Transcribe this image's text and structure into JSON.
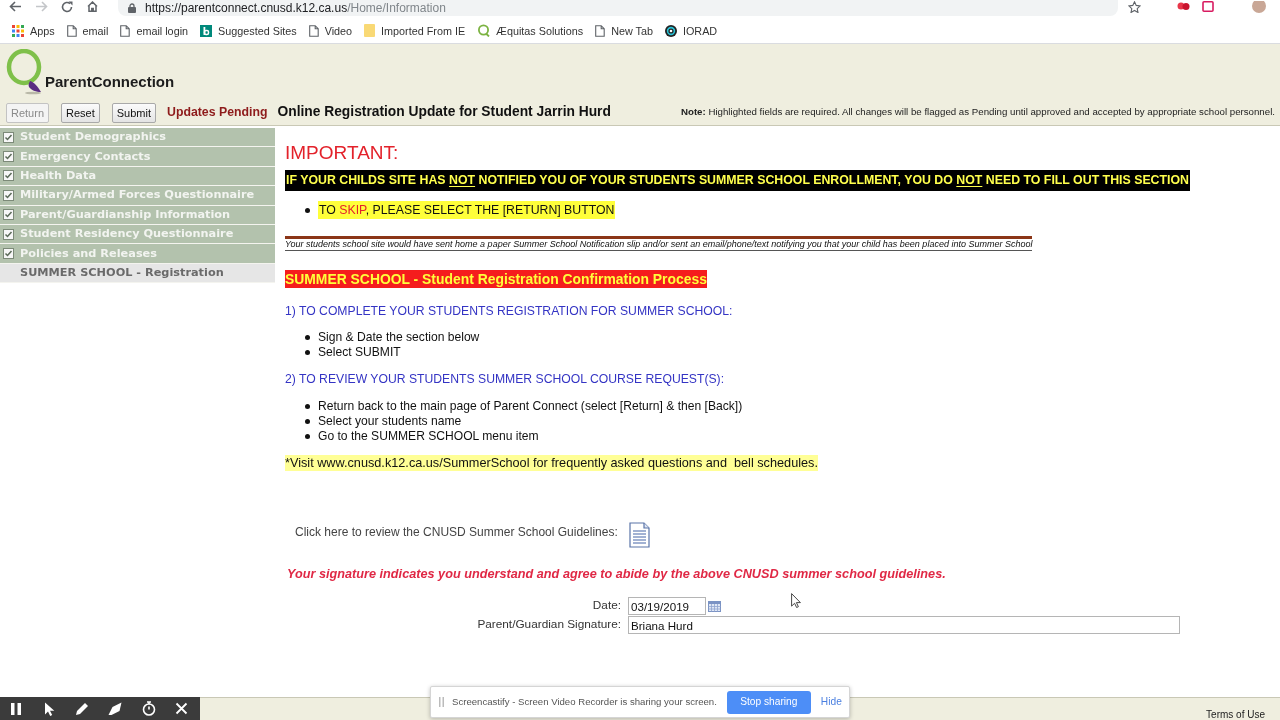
{
  "browser": {
    "url": {
      "host": "https://parentconnect.cnusd.k12.ca.us",
      "path": "/Home/Information"
    },
    "bookmarks": [
      {
        "label": "Apps",
        "kind": "apps"
      },
      {
        "label": "email",
        "kind": "page"
      },
      {
        "label": "email login",
        "kind": "page"
      },
      {
        "label": "Suggested Sites",
        "kind": "tile"
      },
      {
        "label": "Video",
        "kind": "page"
      },
      {
        "label": "Imported From IE",
        "kind": "folder"
      },
      {
        "label": "Æquitas Solutions",
        "kind": "ring"
      },
      {
        "label": "New Tab",
        "kind": "page"
      },
      {
        "label": "IORAD",
        "kind": "disc"
      }
    ]
  },
  "header": {
    "logo": "ParentConnection"
  },
  "toolbar": {
    "buttons": [
      {
        "label": "Return",
        "disabled": true
      },
      {
        "label": "Reset",
        "disabled": false
      },
      {
        "label": "Submit",
        "disabled": false
      }
    ],
    "status": "Updates Pending",
    "title": "Online Registration Update for Student Jarrin Hurd",
    "note": "**Note:** Highlighted fields are required. All changes will be flagged as Pending until approved and accepted by appropriate school personnel."
  },
  "sidebar": {
    "items": [
      {
        "label": "Student Demographics",
        "checked": true,
        "selected": false
      },
      {
        "label": "Emergency Contacts",
        "checked": true,
        "selected": false
      },
      {
        "label": "Health Data",
        "checked": true,
        "selected": false
      },
      {
        "label": "Military/Armed Forces Questionnaire",
        "checked": true,
        "selected": false
      },
      {
        "label": "Parent/Guardianship Information",
        "checked": true,
        "selected": false
      },
      {
        "label": "Student Residency Questionnaire",
        "checked": true,
        "selected": false
      },
      {
        "label": "Policies and Releases",
        "checked": true,
        "selected": false
      },
      {
        "label": "SUMMER SCHOOL - Registration",
        "checked": false,
        "selected": true
      }
    ]
  },
  "content": {
    "important": "IMPORTANT:",
    "banner": [
      {
        "text": "IF YOUR CHILDS SITE HAS ",
        "kind": "plain"
      },
      {
        "text": "NOT",
        "kind": "underline"
      },
      {
        "text": " NOTIFIED YOU OF YOUR STUDENTS SUMMER SCHOOL ENROLLMENT, YOU DO ",
        "kind": "plain"
      },
      {
        "text": "NOT",
        "kind": "underline"
      },
      {
        "text": " NEED TO FILL OUT THIS SECTION",
        "kind": "plain"
      }
    ],
    "skip_bullet": [
      {
        "text": "TO ",
        "kind": "plain"
      },
      {
        "text": "SKIP",
        "kind": "red"
      },
      {
        "text": ", PLEASE SELECT THE [RETURN] BUTTON",
        "kind": "plain"
      }
    ],
    "notice": "Your students school site would have sent home a paper Summer School Notification slip and/or sent an email/phone/text notifying you that your child has been placed into Summer School",
    "section_heading": "SUMMER SCHOOL - Student Registration Confirmation Process",
    "steps": [
      {
        "heading": "1) TO COMPLETE YOUR STUDENTS REGISTRATION FOR SUMMER SCHOOL:",
        "bullets": [
          "Sign & Date the section below",
          "Select SUBMIT"
        ]
      },
      {
        "heading": "2) TO REVIEW YOUR STUDENTS SUMMER SCHOOL COURSE REQUEST(S):",
        "bullets": [
          "Return back to the main page of Parent Connect (select [Return] & then [Back])",
          "Select your students name",
          "Go to the SUMMER SCHOOL menu item"
        ]
      }
    ],
    "visit": {
      "before": "*Visit ",
      "link": "www.cnusd.k12.ca.us/SummerSchool",
      "after": " for frequently asked questions and  bell schedules."
    },
    "guidelines_label": "Click here to review the CNUSD Summer School Guidelines:",
    "agreement": "Your signature indicates you understand and agree to abide by the above CNUSD summer school guidelines.",
    "fields": [
      {
        "label": "Date:",
        "value": "03/19/2019",
        "kind": "date"
      },
      {
        "label": "Parent/Guardian Signature:",
        "value": "Briana Hurd",
        "kind": "text"
      }
    ]
  },
  "footer": {
    "link": "Terms of Use"
  },
  "share_bar": {
    "message": "Screencastify - Screen Video Recorder is sharing your screen.",
    "button": "Stop sharing",
    "link": "Hide"
  }
}
